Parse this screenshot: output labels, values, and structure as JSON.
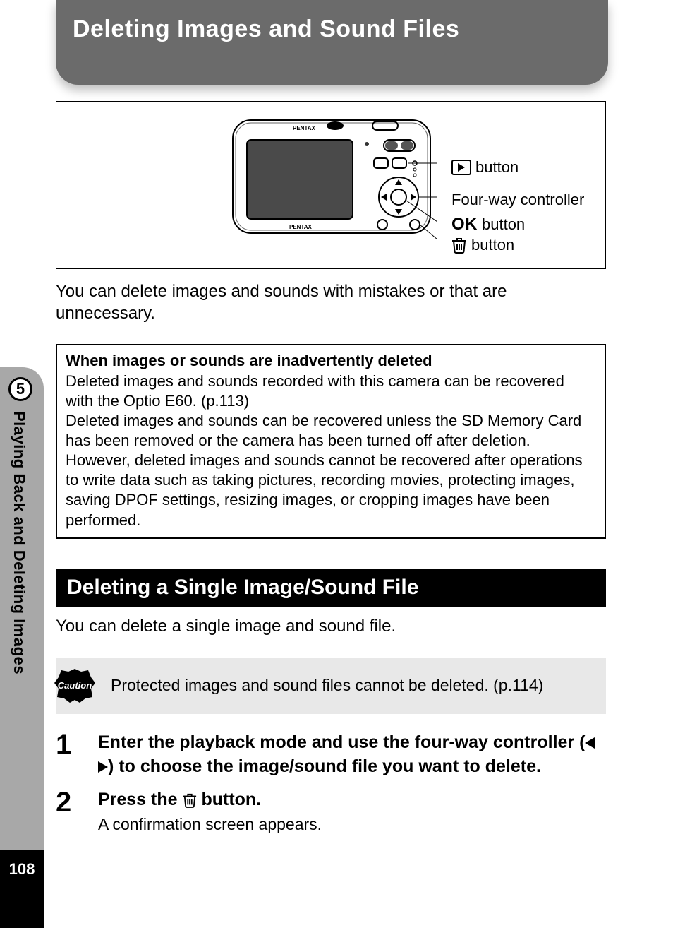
{
  "page_number": "108",
  "chapter_number": "5",
  "side_label": "Playing Back and Deleting Images",
  "header_title": "Deleting Images and Sound Files",
  "diagram": {
    "callout_play": "button",
    "callout_fourway": "Four-way controller",
    "callout_ok_prefix": "OK",
    "callout_ok_suffix": "button",
    "callout_trash": "button",
    "brand_top": "PENTAX",
    "brand_bottom": "PENTAX"
  },
  "intro": "You can delete images and sounds with mistakes or that are unnecessary.",
  "info_box": {
    "title": "When images or sounds are inadvertently deleted",
    "p1": "Deleted images and sounds recorded with this camera can be recovered with the Optio E60. (p.113)",
    "p2": "Deleted images and sounds can be recovered unless the SD Memory Card has been removed or the camera has been turned off after deletion.",
    "p3": "However, deleted images and sounds cannot be recovered after operations to write data such as taking pictures, recording movies, protecting images, saving DPOF settings, resizing images, or cropping images have been performed."
  },
  "section_heading": "Deleting a Single Image/Sound File",
  "sub_intro": "You can delete a single image and sound file.",
  "caution": {
    "badge": "Caution",
    "text": "Protected images and sound files cannot be deleted. (p.114)"
  },
  "steps": {
    "s1_num": "1",
    "s1_title_a": "Enter the playback mode and use the four-way controller (",
    "s1_title_b": ") to choose the image/sound file you want to delete.",
    "s2_num": "2",
    "s2_title_a": "Press the ",
    "s2_title_b": " button.",
    "s2_detail": "A confirmation screen appears."
  }
}
